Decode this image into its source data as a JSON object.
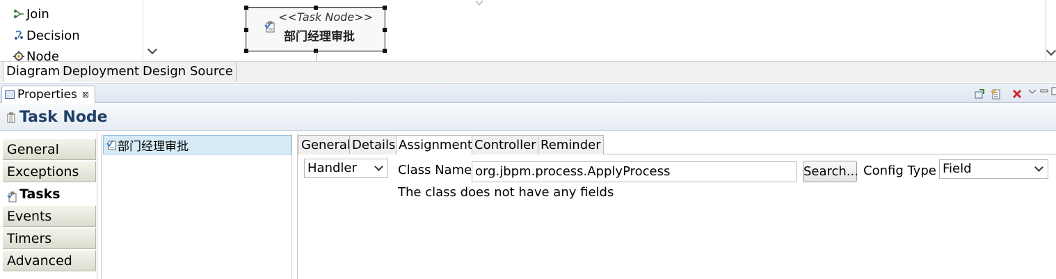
{
  "palette": {
    "items": [
      {
        "label": "Join",
        "icon": "join-icon"
      },
      {
        "label": "Decision",
        "icon": "decision-icon"
      },
      {
        "label": "Node",
        "icon": "node-icon"
      }
    ]
  },
  "diagram": {
    "node": {
      "stereotype": "<<Task Node>>",
      "name": "部门经理审批",
      "icon": "task-node-icon"
    }
  },
  "editor_tabs": [
    {
      "label": "Diagram",
      "active": true
    },
    {
      "label": "Deployment",
      "active": false
    },
    {
      "label": "Design",
      "active": false
    },
    {
      "label": "Source",
      "active": false
    }
  ],
  "properties": {
    "view_title": "Properties",
    "close_glyph": "⊠",
    "section_title": "Task Node",
    "categories": [
      {
        "label": "General",
        "active": false
      },
      {
        "label": "Exceptions",
        "active": false
      },
      {
        "label": "Tasks",
        "active": true
      },
      {
        "label": "Events",
        "active": false
      },
      {
        "label": "Timers",
        "active": false
      },
      {
        "label": "Advanced",
        "active": false
      }
    ],
    "task_list": [
      "部门经理审批"
    ],
    "detail_tabs": [
      {
        "label": "General",
        "active": false
      },
      {
        "label": "Details",
        "active": false
      },
      {
        "label": "Assignment",
        "active": true
      },
      {
        "label": "Controller",
        "active": false
      },
      {
        "label": "Reminder",
        "active": false
      }
    ],
    "assignment": {
      "handler_type": "Handler",
      "class_name_label": "Class Name",
      "class_name_value": "org.jbpm.process.ApplyProcess",
      "search_label": "Search...",
      "config_type_label": "Config Type",
      "config_type_value": "Field",
      "message": "The class does not have any fields"
    }
  },
  "colors": {
    "title_text": "#1e3f66",
    "selection_bg": "#d7ebf7",
    "header_bg": "#dfe6f0"
  }
}
